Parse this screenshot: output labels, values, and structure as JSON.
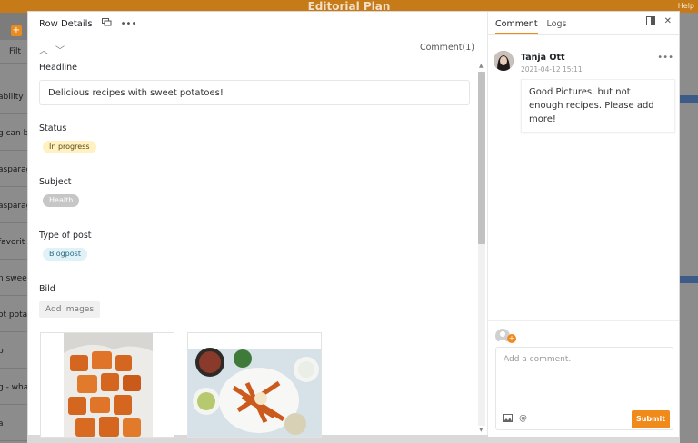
{
  "background": {
    "app_title": "Editorial Plan",
    "help_label": "Help",
    "rows": [
      "ability",
      "g can b",
      "asparag",
      "asparag",
      "favorit",
      "n sweet",
      "ot potat",
      "b",
      "g - wha",
      "a"
    ],
    "filter_label": "Filt"
  },
  "modal": {
    "title": "Row Details",
    "comment_count": "Comment(1)",
    "fields": {
      "headline_label": "Headline",
      "headline_value": "Delicious recipes with sweet potatoes!",
      "status_label": "Status",
      "status_value": "In progress",
      "subject_label": "Subject",
      "subject_value": "Health",
      "type_label": "Type of post",
      "type_value": "Blogpost",
      "bild_label": "Bild",
      "add_images_label": "Add images"
    }
  },
  "panel": {
    "tabs": [
      "Comment",
      "Logs"
    ],
    "comment": {
      "author": "Tanja Ott",
      "time": "2021-04-12 15:11",
      "text": "Good Pictures, but not enough recipes. Please add more!"
    },
    "compose": {
      "placeholder": "Add a comment.",
      "submit_label": "Submit",
      "at_label": "@"
    }
  },
  "colors": {
    "accent": "#f08a1a",
    "status_bg": "#fff1c2",
    "subject_bg": "#c6c6c6",
    "type_bg": "#dff2f8",
    "app_header": "#c67a18"
  }
}
